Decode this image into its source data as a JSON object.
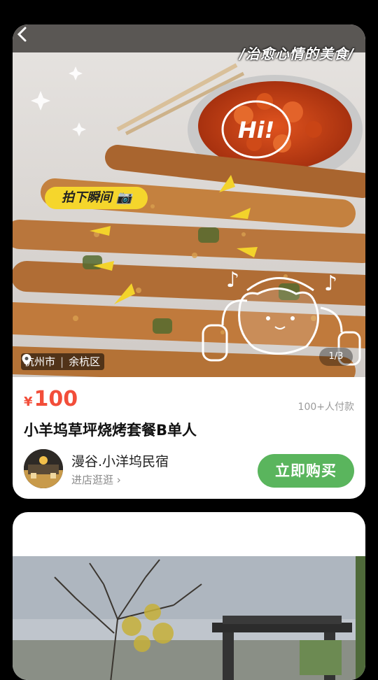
{
  "card": {
    "image_caption": "/治愈心情的美食/",
    "photo_tag": "拍下瞬间",
    "sticker_text": "Hi!",
    "location": {
      "city": "杭州市",
      "district": "余杭区"
    },
    "image_counter": "1/3",
    "price": {
      "currency": "¥",
      "value": "100"
    },
    "paid_count": "100+人付款",
    "title": "小羊坞草坪烧烤套餐B单人",
    "shop": {
      "name": "漫谷.小洋坞民宿",
      "link_label": "进店逛逛"
    },
    "buy_button": "立即购买"
  },
  "colors": {
    "price": "#f24e3a",
    "buy_button": "#5ab55d",
    "tag": "#f5d62c"
  }
}
